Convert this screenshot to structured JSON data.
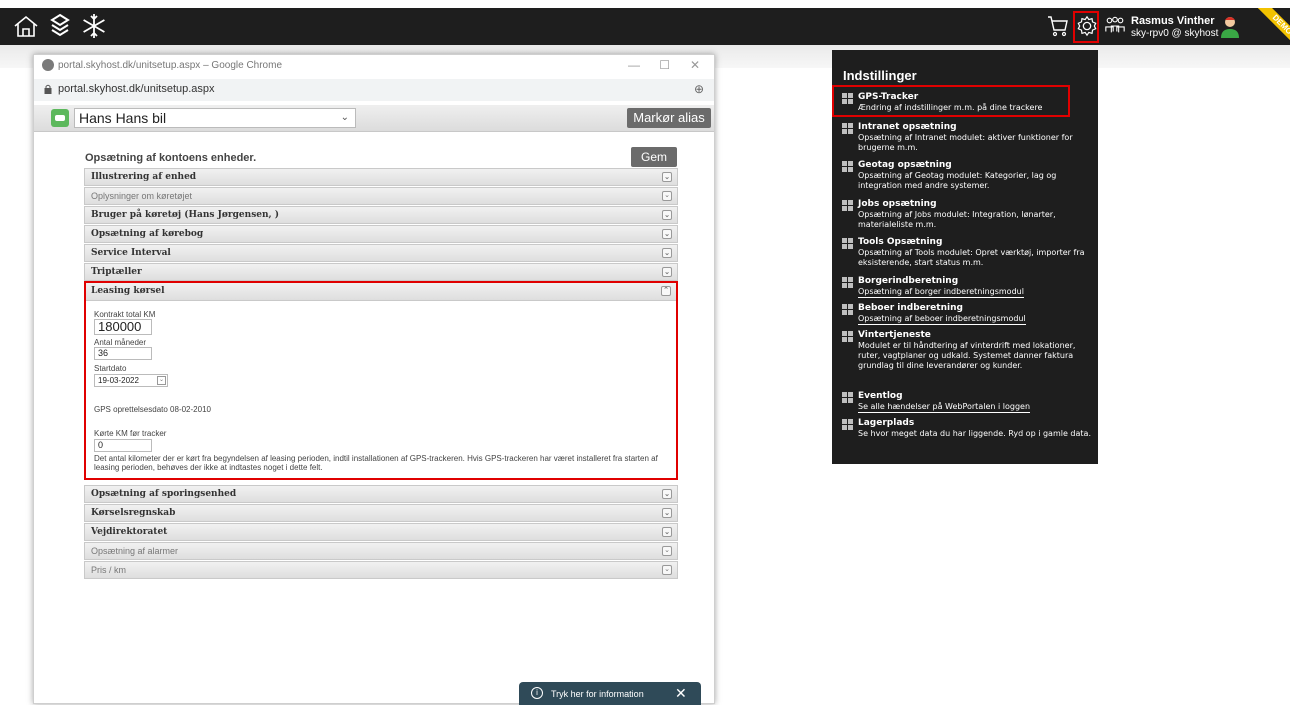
{
  "topbar": {
    "icons": [
      "home-icon",
      "layers-icon",
      "snowflake-icon",
      "cart-icon",
      "gear-icon",
      "users-icon",
      "user-avatar-icon"
    ],
    "user_name": "Rasmus Vinther",
    "user_sub": "sky-rpv0 @ skyhost",
    "ribbon": "DEMO",
    "ribbon_color": "#f2c200"
  },
  "browser": {
    "window_title": "portal.skyhost.dk/unitsetup.aspx – Google Chrome",
    "url": "portal.skyhost.dk/unitsetup.aspx",
    "minimize": "—",
    "maximize": "☐",
    "close": "✕"
  },
  "unitbar": {
    "selected_unit": "Hans Hans bil",
    "alias_button": "Markør alias"
  },
  "setup": {
    "title": "Opsætning af kontoens enheder.",
    "save_button": "Gem",
    "sections_top": [
      "Illustrering af enhed",
      "Oplysninger om køretøjet",
      "Bruger på køretøj (Hans Jørgensen, )",
      "Opsætning af kørebog",
      "Service Interval",
      "Triptæller"
    ],
    "leasing": {
      "header": "Leasing kørsel",
      "contract_label": "Kontrakt total KM",
      "contract_value": "180000",
      "months_label": "Antal måneder",
      "months_value": "36",
      "start_label": "Startdato",
      "start_value": "19-03-2022",
      "gps_created": "GPS oprettelsesdato 08-02-2010",
      "driven_label": "Kørte KM før tracker",
      "driven_value": "0",
      "note": "Det antal kilometer der er kørt fra begyndelsen af leasing perioden, indtil installationen af GPS-trackeren. Hvis GPS-trackeren har været installeret fra starten af leasing perioden, behøves der ikke at indtastes noget i dette felt."
    },
    "sections_bottom": [
      "Opsætning af sporingsenhed",
      "Kørselsregnskab",
      "Vejdirektoratet",
      "Opsætning af alarmer",
      "Pris / km"
    ]
  },
  "info_pill": {
    "icon": "info-icon",
    "text": "Tryk her for information",
    "close": "✕"
  },
  "settings": {
    "title": "Indstillinger",
    "items": [
      {
        "name": "GPS-Tracker",
        "desc": "Ændring af indstillinger m.m. på dine trackere"
      },
      {
        "name": "Intranet opsætning",
        "desc": "Opsætning af Intranet modulet: aktiver funktioner for brugerne m.m."
      },
      {
        "name": "Geotag opsætning",
        "desc": "Opsætning af Geotag modulet: Kategorier, lag og integration med andre systemer."
      },
      {
        "name": "Jobs opsætning",
        "desc": "Opsætning af Jobs modulet: Integration, lønarter, materialeliste m.m."
      },
      {
        "name": "Tools Opsætning",
        "desc": "Opsætning af Tools modulet: Opret værktøj, importer fra eksisterende, start status m.m."
      },
      {
        "name": "Borgerindberetning",
        "desc": "Opsætning af borger indberetningsmodul"
      },
      {
        "name": "Beboer indberetning",
        "desc": "Opsætning af beboer indberetningsmodul"
      },
      {
        "name": "Vintertjeneste",
        "desc": "Modulet er til håndtering af vinterdrift med lokationer, ruter, vagtplaner og udkald. Systemet danner faktura grundlag til dine leverandører og kunder."
      },
      {
        "name": "Eventlog",
        "desc": "Se alle hændelser på WebPortalen i loggen"
      },
      {
        "name": "Lagerplads",
        "desc": "Se hvor meget data du har liggende. Ryd op i gamle data."
      }
    ]
  }
}
